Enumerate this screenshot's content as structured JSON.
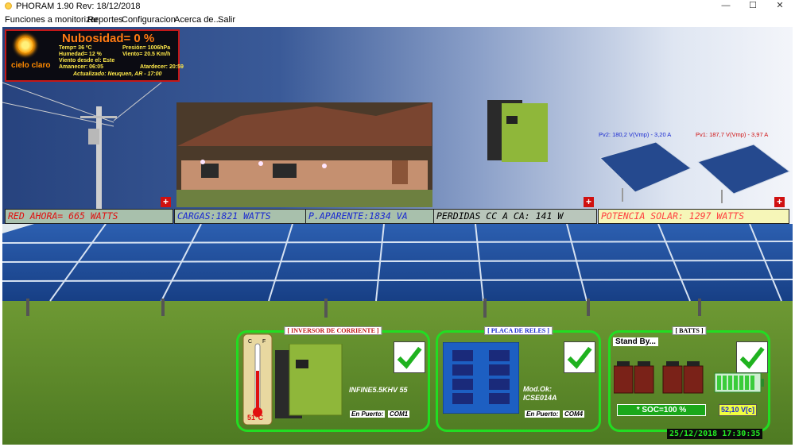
{
  "window": {
    "title": "PHORAM 1.90 Rev: 18/12/2018",
    "minimize": "—",
    "maximize": "☐",
    "close": "✕"
  },
  "menu": [
    "Funciones a monitorizar",
    "Reportes",
    "Configuracion",
    "Acerca de...",
    "Salir"
  ],
  "weather": {
    "nubosidad": "Nubosidad= 0 %",
    "condition": "cielo claro",
    "temp": "Temp= 36 ºC",
    "presion": "Presión= 1006hPa",
    "humedad": "Humedad= 12 %",
    "viento": "Viento= 20.5 Km/h",
    "viento_desde": "Viento desde el: Este",
    "amanecer": "Amanecer: 06:05",
    "atardecer": "Atardecer: 20:59",
    "actualizado": "Actualizado: Neuquen, AR - 17:00"
  },
  "pv": {
    "pv2": "Pv2: 180,2 V(Vmp) - 3,20 A",
    "pv1": "Pv1: 187,7 V(Vmp) - 3,97 A"
  },
  "readouts": {
    "red": "RED AHORA= 665 WATTS",
    "cargas": "CARGAS:1821 WATTS",
    "aparente": "P.APARENTE:1834 VA",
    "perdidas": "PERDIDAS CC A CA: 141 W",
    "solar": "POTENCIA SOLAR: 1297 WATTS"
  },
  "panels": {
    "inversor": {
      "title": "[ INVERSOR DE CORRIENTE ]",
      "model": "INFINE5.5KHV 55",
      "port_label": "En Puerto:",
      "port": "COM1",
      "temp": "51°C"
    },
    "reles": {
      "title": "[ PLACA DE RELES ]",
      "mod_ok": "Mod.Ok:",
      "model": "ICSE014A",
      "port_label": "En Puerto:",
      "port": "COM4"
    },
    "batts": {
      "title": "[ BATTS ]",
      "status": "Stand By...",
      "soc": "* SOC=100 %",
      "voltage": "52,10 V[c]"
    }
  },
  "datetime": "25/12/2018 17:30:35",
  "colors": {
    "readout_red": "#e01010",
    "readout_blue": "#1a2ad0",
    "check": "#1fb21f",
    "panel_border": "#22dd22"
  }
}
